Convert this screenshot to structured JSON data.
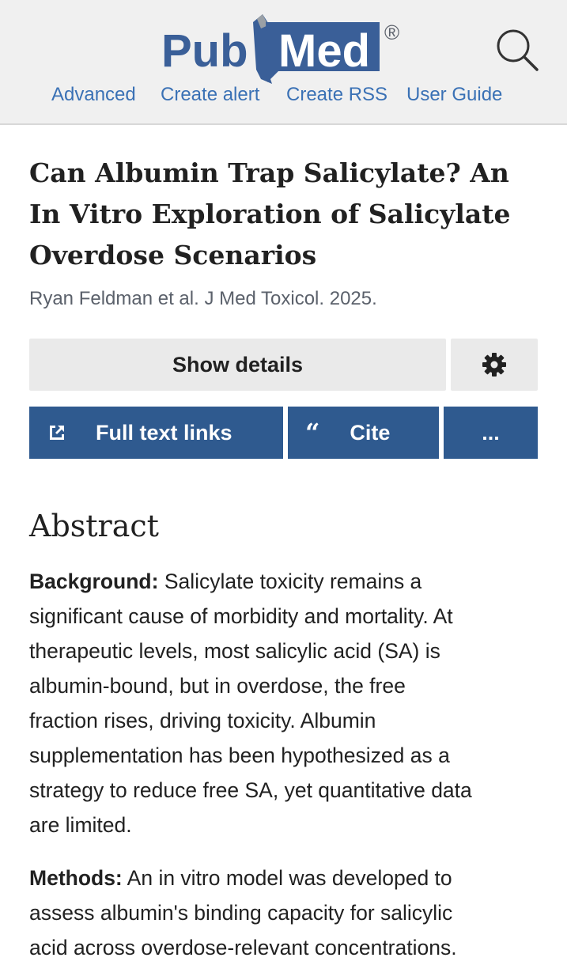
{
  "header": {
    "logo_pub": "Pub",
    "logo_med": "Med",
    "logo_reg": "®",
    "nav": [
      "Advanced",
      "Create alert",
      "Create RSS",
      "User Guide"
    ]
  },
  "article": {
    "title_lines": [
      "Can Albumin Trap Salicylate? An",
      "In Vitro Exploration of Salicylate",
      "Overdose Scenarios"
    ],
    "authors": "Ryan Feldman et al. J Med Toxicol. 2025."
  },
  "actions": {
    "show_details": "Show details",
    "full_text_links": "Full text links",
    "cite": "Cite",
    "more": "..."
  },
  "abstract": {
    "heading": "Abstract",
    "background_label": "Background:",
    "background_lines": [
      "Salicylate toxicity remains a",
      "significant cause of morbidity and mortality. At",
      "therapeutic levels, most salicylic acid (SA) is",
      "albumin-bound, but in overdose, the free",
      "fraction rises, driving toxicity. Albumin",
      "supplementation has been hypothesized as a",
      "strategy to reduce free SA, yet quantitative data",
      "are limited."
    ],
    "methods_label": "Methods:",
    "methods_lines": [
      "An in vitro model was developed to",
      "assess albumin's binding capacity for salicylic",
      "acid across overdose-relevant concentrations."
    ]
  }
}
